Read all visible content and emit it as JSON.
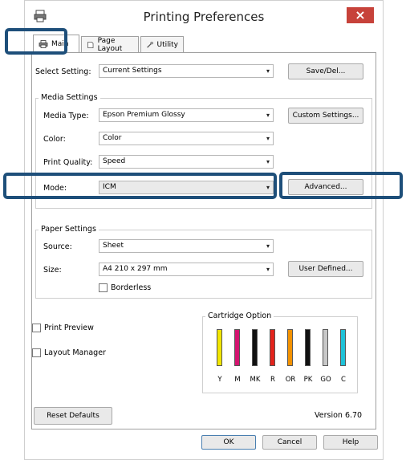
{
  "window": {
    "title": "Printing Preferences",
    "close_symbol": "×",
    "app_icon": "printer-icon"
  },
  "tabs": [
    {
      "label": "Main",
      "icon": "printer-icon",
      "active": true
    },
    {
      "label": "Page Layout",
      "icon": "page-icon",
      "active": false
    },
    {
      "label": "Utility",
      "icon": "wrench-icon",
      "active": false
    }
  ],
  "select_setting": {
    "label": "Select Setting:",
    "value": "Current Settings",
    "button": "Save/Del..."
  },
  "media_settings": {
    "title": "Media Settings",
    "media_type": {
      "label": "Media Type:",
      "value": "Epson Premium Glossy"
    },
    "custom_button": "Custom Settings...",
    "color": {
      "label": "Color:",
      "value": "Color"
    },
    "print_quality": {
      "label": "Print Quality:",
      "value": "Speed"
    },
    "mode": {
      "label": "Mode:",
      "value": "ICM"
    },
    "advanced_button": "Advanced..."
  },
  "paper_settings": {
    "title": "Paper Settings",
    "source": {
      "label": "Source:",
      "value": "Sheet"
    },
    "size": {
      "label": "Size:",
      "value": "A4 210 x 297 mm"
    },
    "user_defined_button": "User Defined...",
    "borderless": {
      "label": "Borderless",
      "checked": false
    }
  },
  "print_preview": {
    "label": "Print Preview",
    "checked": false
  },
  "layout_manager": {
    "label": "Layout Manager",
    "checked": false
  },
  "cartridge_option": {
    "title": "Cartridge Option",
    "cartridges": [
      {
        "label": "Y",
        "color": "#f2e600",
        "level": 1.0
      },
      {
        "label": "M",
        "color": "#d4146f",
        "level": 1.0
      },
      {
        "label": "MK",
        "color": "#111111",
        "level": 1.0
      },
      {
        "label": "R",
        "color": "#e3231b",
        "level": 1.0
      },
      {
        "label": "OR",
        "color": "#f39200",
        "level": 1.0
      },
      {
        "label": "PK",
        "color": "#111111",
        "level": 1.0
      },
      {
        "label": "GO",
        "color": "#c8c8c8",
        "level": 1.0
      },
      {
        "label": "C",
        "color": "#1ec2d8",
        "level": 1.0
      }
    ]
  },
  "reset_button": "Reset Defaults",
  "version": "Version 6.70",
  "footer": {
    "ok": "OK",
    "cancel": "Cancel",
    "help": "Help"
  },
  "colors": {
    "highlight": "#1e4f7a",
    "close_button": "#c7423a"
  }
}
